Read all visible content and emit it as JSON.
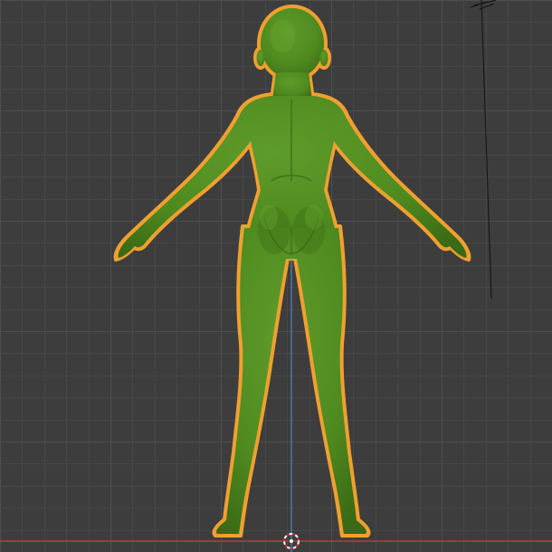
{
  "viewport": {
    "view": "back-orthographic",
    "background_color": "#3d3d3d",
    "grid": {
      "visible": true,
      "minor_color": "#474747",
      "major_color": "#4f4f4f"
    },
    "axes": {
      "x_axis_color": "#a8444a",
      "z_axis_color": "#4a75b0"
    },
    "camera_object": {
      "visible": true,
      "partially_out_of_view": true
    },
    "cursor_3d": {
      "visible": true
    }
  },
  "selected_object": {
    "type": "mesh",
    "description_icon": "humanoid-mesh",
    "material_color": "#4f8a1f",
    "selection_outline_color": "#f0a030",
    "selected": true
  }
}
